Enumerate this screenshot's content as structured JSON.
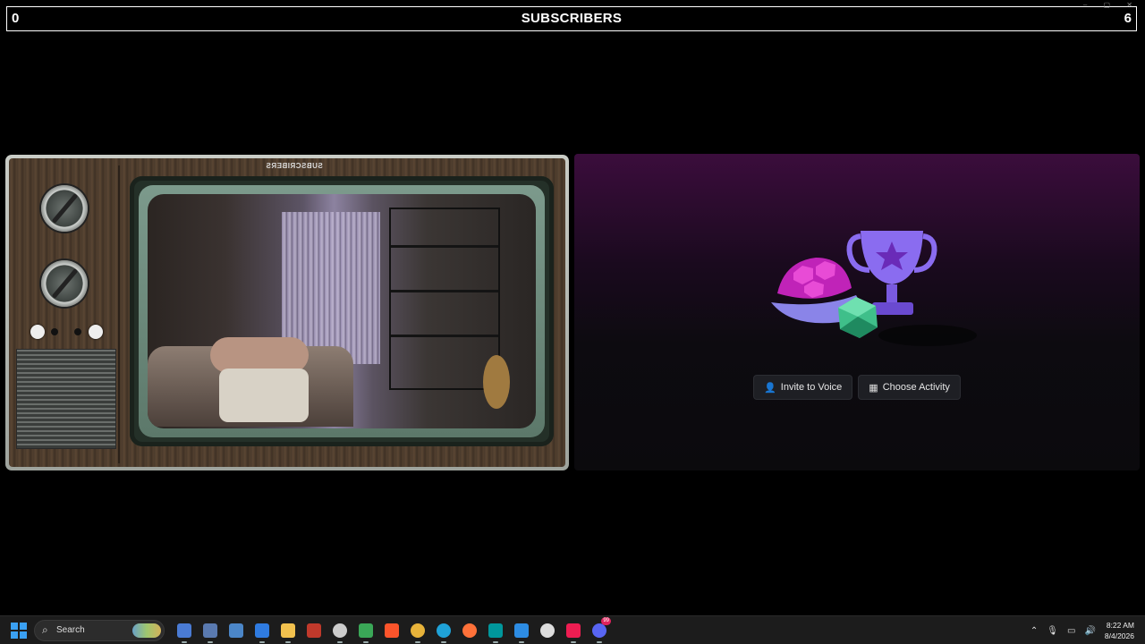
{
  "overlay": {
    "left_count": "0",
    "title": "SUBSCRIBERS",
    "right_count": "6"
  },
  "tv": {
    "brand_mirrored": "SUBSCRIBERS"
  },
  "discord": {
    "invite_label": "Invite to Voice",
    "activity_label": "Choose Activity",
    "accent": "#3b0d3c"
  },
  "taskbar": {
    "search_label": "Search",
    "apps": [
      {
        "name": "app-r-icon",
        "color": "#4a7bd4"
      },
      {
        "name": "network-tool-icon",
        "color": "#5a7ab0"
      },
      {
        "name": "remote-desktop-icon",
        "color": "#4b86c8"
      },
      {
        "name": "app-blue-r-icon",
        "color": "#2f7be0"
      },
      {
        "name": "file-explorer-icon",
        "color": "#f2c14e"
      },
      {
        "name": "voicemeeter-icon",
        "color": "#c0392b"
      },
      {
        "name": "obs-icon",
        "color": "#cccccc"
      },
      {
        "name": "vpn-icon",
        "color": "#3aa757"
      },
      {
        "name": "brave-icon",
        "color": "#fb542b"
      },
      {
        "name": "chrome-icon",
        "color": "#e8b33a"
      },
      {
        "name": "edge-icon",
        "color": "#1fa2d8"
      },
      {
        "name": "firefox-icon",
        "color": "#ff7139"
      },
      {
        "name": "arduino-icon",
        "color": "#00979c"
      },
      {
        "name": "vscode-icon",
        "color": "#2d8ce3"
      },
      {
        "name": "openai-icon",
        "color": "#dddddd"
      },
      {
        "name": "tiktok-icon",
        "color": "#ee1d52"
      },
      {
        "name": "discord-icon",
        "color": "#5865f2"
      }
    ],
    "discord_badge": "99",
    "time": "8:22 AM",
    "date": "8/4/2026"
  }
}
